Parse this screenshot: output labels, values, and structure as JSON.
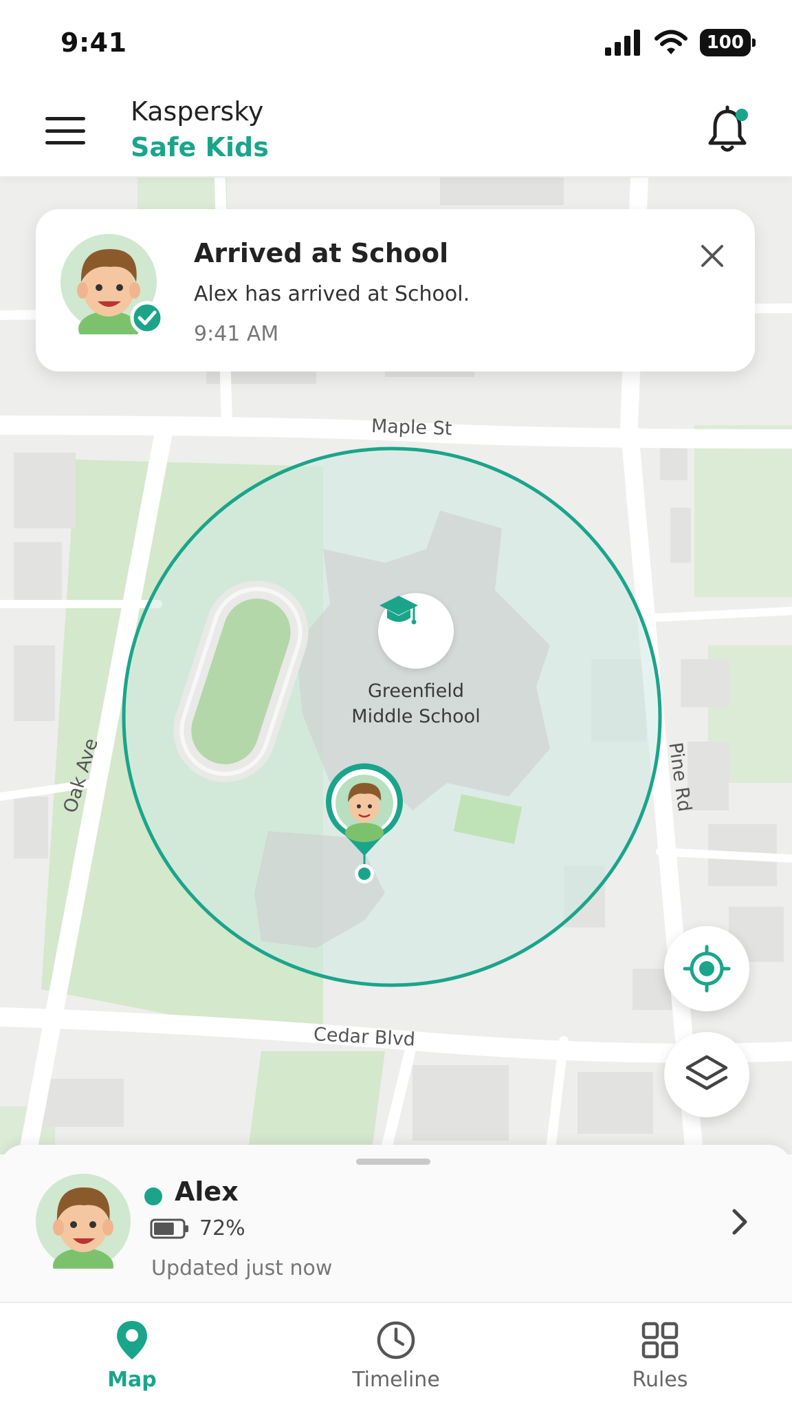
{
  "status_bar": {
    "time": "9:41",
    "battery": "100"
  },
  "header": {
    "brand_line1": "Kaspersky",
    "brand_line2": "Safe Kids"
  },
  "notification": {
    "title": "Arrived at School",
    "body": "Alex has arrived at School.",
    "time": "9:41 AM"
  },
  "map": {
    "streets": {
      "top": "Maple St",
      "left": "Oak Ave",
      "right": "Pine Rd",
      "bottom": "Cedar Blvd"
    },
    "place_name_line1": "Greenfield",
    "place_name_line2": "Middle School",
    "geofence_color": "#1aa58b"
  },
  "child": {
    "name": "Alex",
    "status": "online",
    "battery_percent": "72%",
    "battery_level": 0.72,
    "updated": "Updated just now"
  },
  "nav": {
    "tabs": [
      {
        "label": "Map",
        "icon": "map-pin-icon",
        "active": true
      },
      {
        "label": "Timeline",
        "icon": "clock-icon",
        "active": false
      },
      {
        "label": "Rules",
        "icon": "grid-icon",
        "active": false
      }
    ]
  },
  "colors": {
    "accent": "#1aa58b",
    "text": "#222222"
  }
}
